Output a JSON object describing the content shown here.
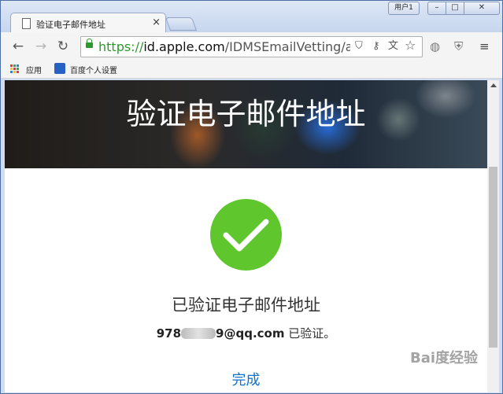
{
  "browser": {
    "tab": {
      "title": "验证电子邮件地址",
      "close": "×"
    },
    "user_badge": "用户1",
    "window_controls": {
      "minimize": "–",
      "maximize": "□",
      "close": "✕"
    },
    "nav": {
      "back": "←",
      "forward": "→",
      "reload": "↻"
    },
    "address": {
      "scheme": "https://",
      "host": "id.apple.com",
      "path": "/IDMSEmailVetting/authe"
    },
    "bookmarks": [
      {
        "label": "应用",
        "icon": "apps-grid-icon"
      },
      {
        "label": "百度个人设置",
        "icon": "baidu-paw-icon"
      }
    ],
    "icons": [
      "shield-icon",
      "key-icon",
      "translate-icon",
      "star-icon",
      "globe-icon",
      "extension-shield-icon",
      "menu-icon"
    ]
  },
  "page": {
    "hero_title": "验证电子邮件地址",
    "verified_title": "已验证电子邮件地址",
    "email_prefix": "978",
    "email_suffix": "9@qq.com",
    "email_status": " 已验证。",
    "done_label": "完成"
  },
  "watermark": "Bai度经验",
  "colors": {
    "check": "#5fc62e",
    "link": "#0f73c6",
    "secure": "#2a9a2a"
  }
}
